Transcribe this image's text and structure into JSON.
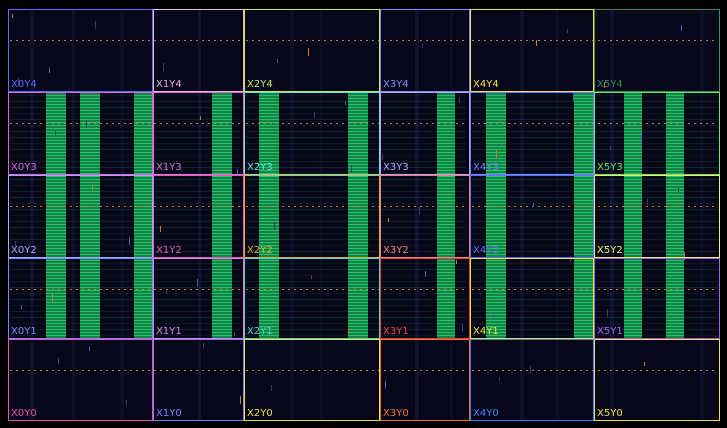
{
  "app": {
    "view": "Device"
  },
  "colors": {
    "background": "#000000",
    "die": "#07071a",
    "routing": "#20c060",
    "dash_orange": "#c08030",
    "dash_blue": "#4060c0"
  },
  "regions": [
    {
      "name": "X0Y4",
      "color": "#5a6cff"
    },
    {
      "name": "X1Y4",
      "color": "#e8b0d8"
    },
    {
      "name": "X2Y4",
      "color": "#c6e85a"
    },
    {
      "name": "X3Y4",
      "color": "#8090ff"
    },
    {
      "name": "X4Y4",
      "color": "#f0e040"
    },
    {
      "name": "X5Y4",
      "color": "#3a8a5a"
    },
    {
      "name": "X0Y3",
      "color": "#e060e0"
    },
    {
      "name": "X1Y3",
      "color": "#e070d0"
    },
    {
      "name": "X2Y3",
      "color": "#60e0e0"
    },
    {
      "name": "X3Y3",
      "color": "#c0a0ff"
    },
    {
      "name": "X4Y3",
      "color": "#7080ff"
    },
    {
      "name": "X5Y3",
      "color": "#70e070"
    },
    {
      "name": "X0Y2",
      "color": "#a0a8ff"
    },
    {
      "name": "X1Y2",
      "color": "#e060c0"
    },
    {
      "name": "X2Y2",
      "color": "#e0b030"
    },
    {
      "name": "X3Y2",
      "color": "#f08080"
    },
    {
      "name": "X4Y2",
      "color": "#6070ff"
    },
    {
      "name": "X5Y2",
      "color": "#f0f060"
    },
    {
      "name": "X0Y1",
      "color": "#7090ff"
    },
    {
      "name": "X1Y1",
      "color": "#e080e0"
    },
    {
      "name": "X2Y1",
      "color": "#50d0d0"
    },
    {
      "name": "X3Y1",
      "color": "#f04040"
    },
    {
      "name": "X4Y1",
      "color": "#f0e030"
    },
    {
      "name": "X5Y1",
      "color": "#a060ff"
    },
    {
      "name": "X0Y0",
      "color": "#f050b0"
    },
    {
      "name": "X1Y0",
      "color": "#8080ff"
    },
    {
      "name": "X2Y0",
      "color": "#e8e040"
    },
    {
      "name": "X3Y0",
      "color": "#f07030"
    },
    {
      "name": "X4Y0",
      "color": "#4080ff"
    },
    {
      "name": "X5Y0",
      "color": "#f0e040"
    }
  ]
}
